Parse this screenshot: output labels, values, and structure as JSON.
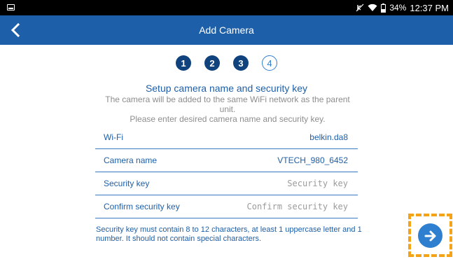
{
  "status_bar": {
    "battery": "34%",
    "time": "12:37 PM",
    "icons": [
      "notification-icon",
      "mute-icon",
      "wifi-icon",
      "battery-icon"
    ]
  },
  "app_bar": {
    "title": "Add Camera",
    "back_icon": "chevron-left-icon"
  },
  "steps": {
    "items": [
      "1",
      "2",
      "3",
      "4"
    ],
    "current": "4"
  },
  "content": {
    "heading": "Setup camera name and security key",
    "description_1": "The camera will be added to the same WiFi network as the parent unit.",
    "description_2": "Please enter desired camera name and security key."
  },
  "form": {
    "wifi": {
      "label": "Wi-Fi",
      "value": "belkin.da8"
    },
    "camera_name": {
      "label": "Camera name",
      "value": "VTECH_980_6452"
    },
    "security_key": {
      "label": "Security key",
      "placeholder": "Security key",
      "value": ""
    },
    "confirm_key": {
      "label": "Confirm security key",
      "placeholder": "Confirm security key",
      "value": ""
    }
  },
  "note": "Security key must contain 8 to 12 characters, at least 1 uppercase letter and 1 number. It should not contain special characters.",
  "next_icon": "arrow-right-icon",
  "colors": {
    "app_bar": "#1d5fa8",
    "step_done": "#10437e",
    "accent": "#2e7fd0",
    "highlight": "#f3a317"
  }
}
